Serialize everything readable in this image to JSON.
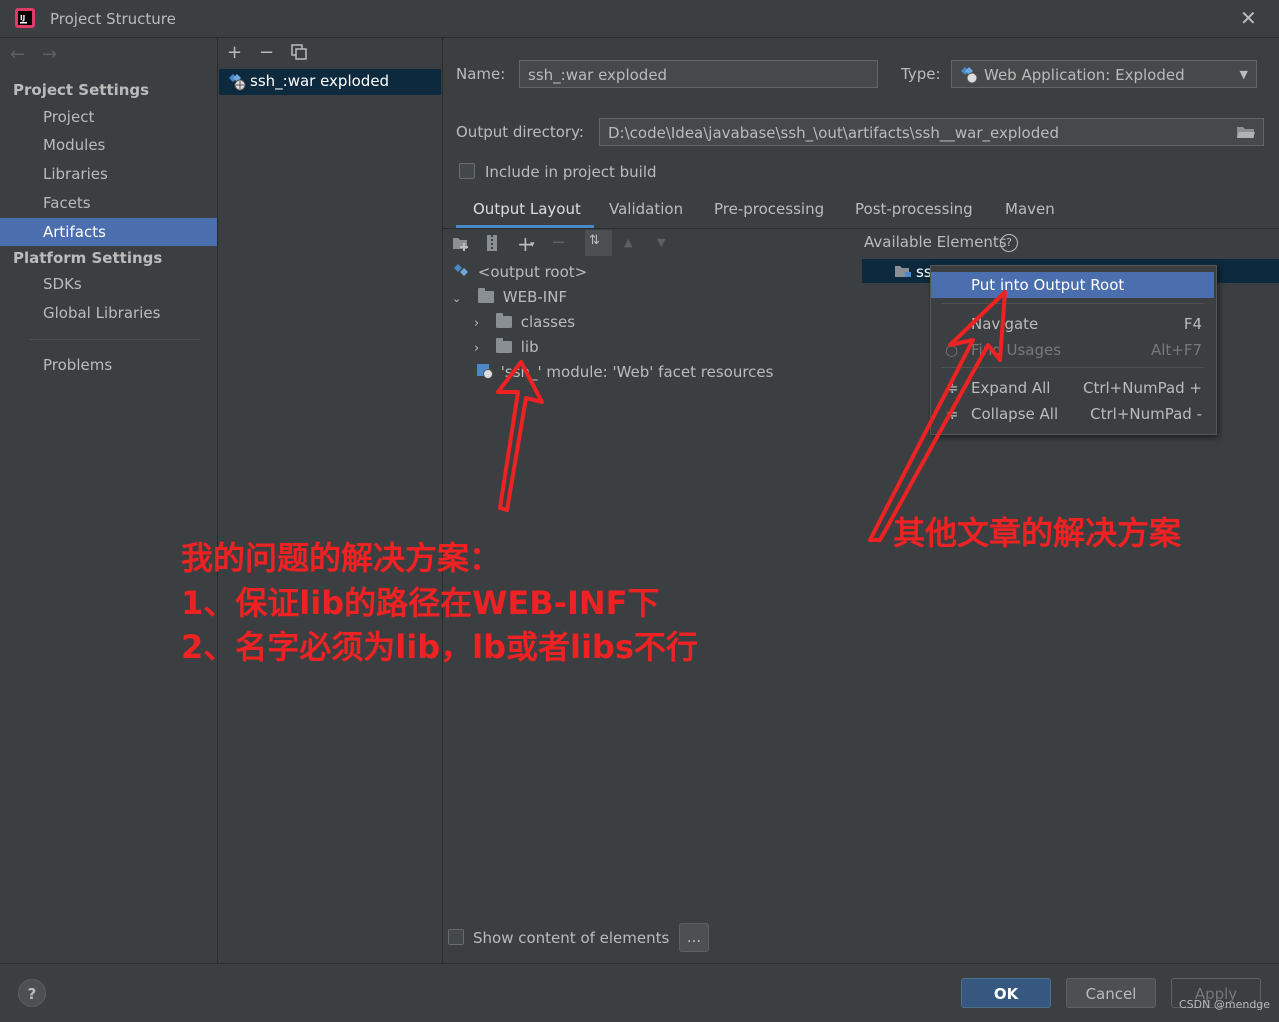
{
  "window": {
    "title": "Project Structure"
  },
  "nav": {
    "project_settings_header": "Project Settings",
    "project_settings_items": [
      "Project",
      "Modules",
      "Libraries",
      "Facets",
      "Artifacts"
    ],
    "platform_settings_header": "Platform Settings",
    "platform_settings_items": [
      "SDKs",
      "Global Libraries"
    ],
    "problems": "Problems",
    "selected": "Artifacts"
  },
  "artifacts_list": {
    "items": [
      "ssh_:war exploded"
    ]
  },
  "form": {
    "name_label": "Name:",
    "name_value": "ssh_:war exploded",
    "type_label": "Type:",
    "type_value": "Web Application: Exploded",
    "output_dir_label": "Output directory:",
    "output_dir_value": "D:\\code\\Idea\\javabase\\ssh_\\out\\artifacts\\ssh__war_exploded",
    "include_in_build_label": "Include in project build",
    "include_in_build_checked": false
  },
  "tabs": [
    "Output Layout",
    "Validation",
    "Pre-processing",
    "Post-processing",
    "Maven"
  ],
  "active_tab": "Output Layout",
  "layout_tree": {
    "root": "<output root>",
    "web_inf": "WEB-INF",
    "classes": "classes",
    "lib": "lib",
    "facet": "'ssh_' module: 'Web' facet resources"
  },
  "available_elements": {
    "label": "Available Elements",
    "row": "ss"
  },
  "context_menu": {
    "put_into_output_root": "Put into Output Root",
    "navigate": "Navigate",
    "navigate_key": "F4",
    "find_usages": "Find Usages",
    "find_usages_key": "Alt+F7",
    "expand_all": "Expand All",
    "expand_all_key": "Ctrl+NumPad +",
    "collapse_all": "Collapse All",
    "collapse_all_key": "Ctrl+NumPad -"
  },
  "show_content_label": "Show content of elements",
  "ellipsis_button": "...",
  "buttons": {
    "help": "?",
    "ok": "OK",
    "cancel": "Cancel",
    "apply": "Apply"
  },
  "annotations": {
    "left_line1": "我的问题的解决方案：",
    "left_line2": "1、保证lib的路径在WEB-INF下",
    "left_line3": "2、名字必须为lib，lb或者libs不行",
    "right": "其他文章的解决方案"
  },
  "watermark": "CSDN @mendge",
  "colors": {
    "selection": "#4b6eaf",
    "annotation": "#ee2222",
    "primary_button": "#365880"
  }
}
